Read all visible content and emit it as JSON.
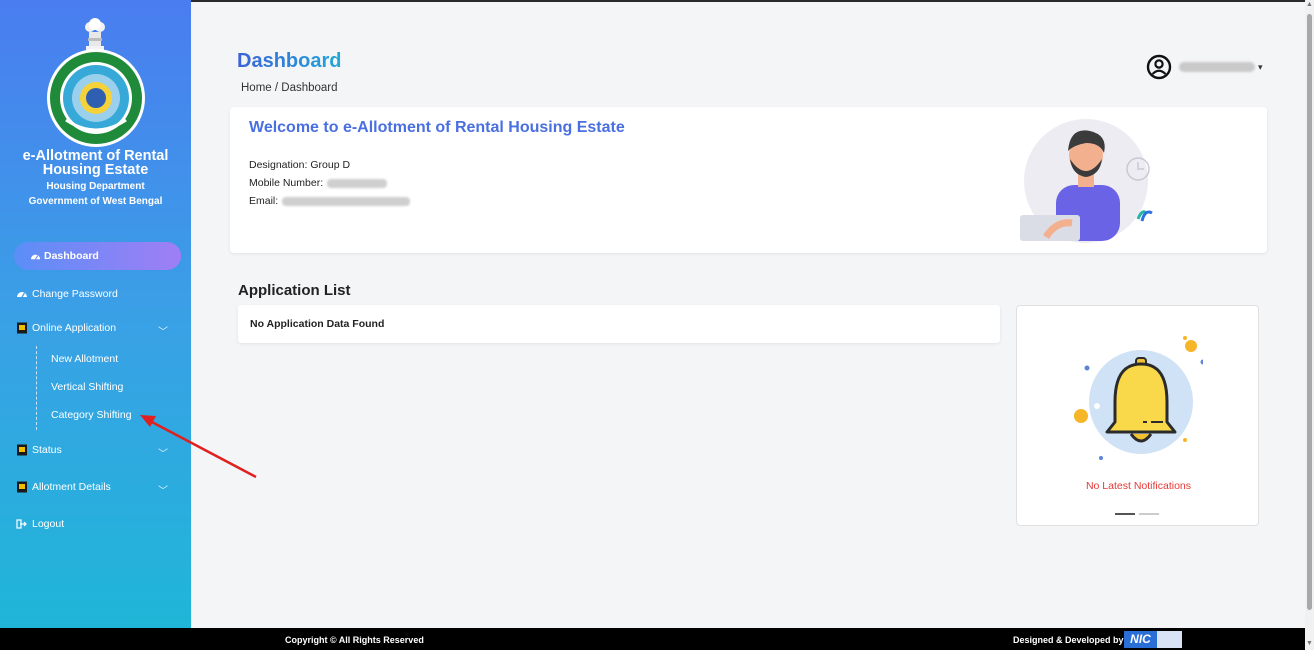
{
  "brand": {
    "title": "e-Allotment of Rental Housing Estate",
    "department": "Housing Department",
    "government": "Government of West Bengal"
  },
  "sidebar": {
    "items": [
      {
        "label": "Dashboard",
        "icon": "dashboard-icon",
        "active": true
      },
      {
        "label": "Change Password",
        "icon": "dashboard-icon"
      },
      {
        "label": "Online Application",
        "icon": "document-icon",
        "expanded": true,
        "children": [
          "New Allotment",
          "Vertical Shifting",
          "Category Shifting"
        ]
      },
      {
        "label": "Status",
        "icon": "document-icon"
      },
      {
        "label": "Allotment Details",
        "icon": "document-icon"
      },
      {
        "label": "Logout",
        "icon": "logout-icon"
      }
    ]
  },
  "header": {
    "title": "Dashboard",
    "breadcrumb": "Home / Dashboard",
    "user_icon": "user-circle-icon"
  },
  "welcome": {
    "title": "Welcome to e-Allotment of Rental Housing Estate",
    "designation_label": "Designation:",
    "designation_value": "Group D",
    "mobile_label": "Mobile Number:",
    "email_label": "Email:"
  },
  "applications": {
    "title": "Application List",
    "empty_text": "No Application Data Found"
  },
  "notifications": {
    "empty_text": "No Latest Notifications"
  },
  "footer": {
    "copyright": "Copyright © All Rights Reserved",
    "designed_by": "Designed & Developed by",
    "nic": "NIC"
  },
  "colors": {
    "sidebar_top": "#4a7df0",
    "sidebar_bottom": "#1fb6d8",
    "accent": "#4a6fe0",
    "notification_text": "#e53935",
    "annotation_arrow": "#e02020"
  }
}
